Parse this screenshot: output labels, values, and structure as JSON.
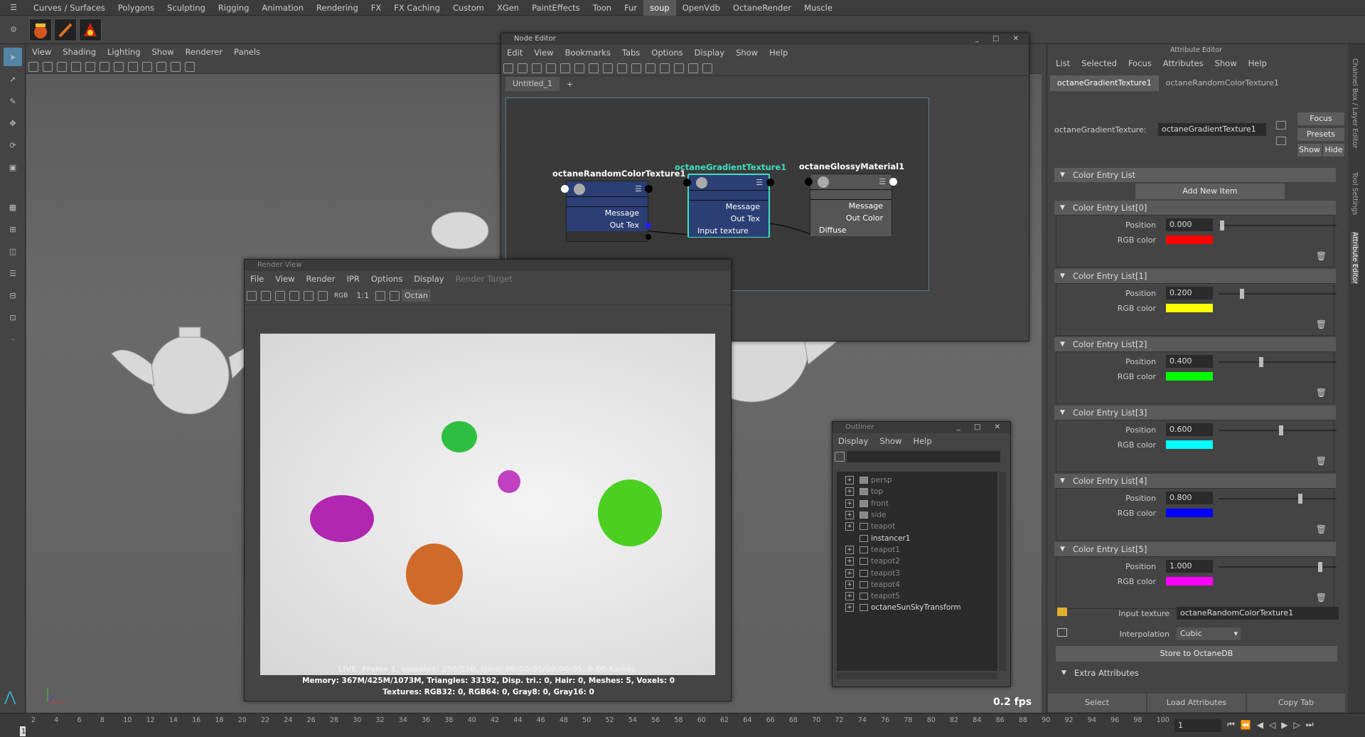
{
  "shelf_tabs": [
    "Curves / Surfaces",
    "Polygons",
    "Sculpting",
    "Rigging",
    "Animation",
    "Rendering",
    "FX",
    "FX Caching",
    "Custom",
    "XGen",
    "PaintEffects",
    "Toon",
    "Fur",
    "soup",
    "OpenVdb",
    "OctaneRender",
    "Muscle"
  ],
  "active_shelf_tab": "soup",
  "viewport": {
    "menu": [
      "View",
      "Shading",
      "Lighting",
      "Show",
      "Renderer",
      "Panels"
    ],
    "fps": "0.2 fps"
  },
  "node_editor": {
    "title": "Node Editor",
    "menu": [
      "Edit",
      "View",
      "Bookmarks",
      "Tabs",
      "Options",
      "Display",
      "Show",
      "Help"
    ],
    "tab": "Untitled_1",
    "add_tab": "+",
    "nodes": {
      "random": {
        "title": "octaneRandomColorTexture1",
        "rows": [
          "Message",
          "Out Tex"
        ]
      },
      "gradient": {
        "title": "octaneGradientTexture1",
        "rows": [
          "Message",
          "Out Tex",
          "Input texture"
        ]
      },
      "glossy": {
        "title": "octaneGlossyMaterial1",
        "rows": [
          "Message",
          "Out Color",
          "Diffuse"
        ]
      }
    }
  },
  "render_view": {
    "title": "Render View",
    "menu": [
      "File",
      "View",
      "Render",
      "IPR",
      "Options",
      "Display",
      "Render Target"
    ],
    "toolbar_labels": {
      "rgb": "RGB",
      "ratio": "1:1",
      "renderer": "Octan"
    },
    "stats": [
      "LIVE. Frame 1, samples: 250/250, time: 00:00:05/00:00:05, 0.00 Ks/sec.",
      "Memory: 367M/425M/1073M, Triangles: 33192, Disp. tri.: 0, Hair: 0, Meshes: 5, Voxels: 0",
      "Textures: RGB32: 0, RGB64: 0, Gray8: 0, Gray16: 0"
    ]
  },
  "outliner": {
    "title": "Outliner",
    "menu": [
      "Display",
      "Show",
      "Help"
    ],
    "items": [
      {
        "label": "persp",
        "dim": true,
        "icon": "camera-icon"
      },
      {
        "label": "top",
        "dim": true,
        "icon": "camera-icon"
      },
      {
        "label": "front",
        "dim": true,
        "icon": "camera-icon"
      },
      {
        "label": "side",
        "dim": true,
        "icon": "camera-icon"
      },
      {
        "label": "teapot",
        "dim": true,
        "icon": "mesh-icon"
      },
      {
        "label": "instancer1",
        "dim": false,
        "icon": "instancer-icon"
      },
      {
        "label": "teapot1",
        "dim": true,
        "icon": "mesh-icon"
      },
      {
        "label": "teapot2",
        "dim": true,
        "icon": "mesh-icon"
      },
      {
        "label": "teapot3",
        "dim": true,
        "icon": "mesh-icon"
      },
      {
        "label": "teapot4",
        "dim": true,
        "icon": "mesh-icon"
      },
      {
        "label": "teapot5",
        "dim": true,
        "icon": "mesh-icon"
      },
      {
        "label": "octaneSunSkyTransform",
        "dim": false,
        "icon": "transform-icon"
      }
    ]
  },
  "attribute_editor": {
    "title": "Attribute Editor",
    "menu": [
      "List",
      "Selected",
      "Focus",
      "Attributes",
      "Show",
      "Help"
    ],
    "tabs": [
      "octaneGradientTexture1",
      "octaneRandomColorTexture1"
    ],
    "node_label": "octaneGradientTexture:",
    "node_value": "octaneGradientTexture1",
    "buttons": {
      "focus": "Focus",
      "presets": "Presets",
      "show": "Show",
      "hide": "Hide"
    },
    "section": "Color Entry List",
    "add_new_item": "Add New Item",
    "position_label": "Position",
    "rgb_label": "RGB color",
    "entries": [
      {
        "name": "Color Entry List[0]",
        "position": "0.000",
        "pos_frac": 0.0,
        "color": "#ff0000"
      },
      {
        "name": "Color Entry List[1]",
        "position": "0.200",
        "pos_frac": 0.2,
        "color": "#ffff00"
      },
      {
        "name": "Color Entry List[2]",
        "position": "0.400",
        "pos_frac": 0.4,
        "color": "#00ff00"
      },
      {
        "name": "Color Entry List[3]",
        "position": "0.600",
        "pos_frac": 0.6,
        "color": "#00ffff"
      },
      {
        "name": "Color Entry List[4]",
        "position": "0.800",
        "pos_frac": 0.8,
        "color": "#0000ff"
      },
      {
        "name": "Color Entry List[5]",
        "position": "1.000",
        "pos_frac": 1.0,
        "color": "#ff00ff"
      }
    ],
    "input_texture_label": "Input texture",
    "input_texture_value": "octaneRandomColorTexture1",
    "interpolation_label": "Interpolation",
    "interpolation_value": "Cubic",
    "store_button": "Store to OctaneDB",
    "extra_section": "Extra Attributes",
    "bottom_buttons": [
      "Select",
      "Load Attributes",
      "Copy Tab"
    ]
  },
  "side_tabs": [
    "Channel Box / Layer Editor",
    "Tool Settings",
    "Attribute Editor"
  ],
  "timeline": {
    "ticks": [
      "2",
      "4",
      "6",
      "8",
      "10",
      "12",
      "14",
      "16",
      "18",
      "20",
      "22",
      "24",
      "26",
      "28",
      "30",
      "32",
      "34",
      "36",
      "38",
      "40",
      "42",
      "44",
      "46",
      "48",
      "50",
      "52",
      "54",
      "56",
      "58",
      "60",
      "62",
      "64",
      "66",
      "68",
      "70",
      "72",
      "74",
      "76",
      "78",
      "80",
      "82",
      "84",
      "86",
      "88",
      "90",
      "92",
      "94",
      "96",
      "98",
      "100"
    ],
    "current_frame": "1",
    "frame_field": "1"
  },
  "colors": {
    "accent": "#5285a6",
    "node_blue": "#2b3f75",
    "selected_border": "#3fe0c0"
  }
}
